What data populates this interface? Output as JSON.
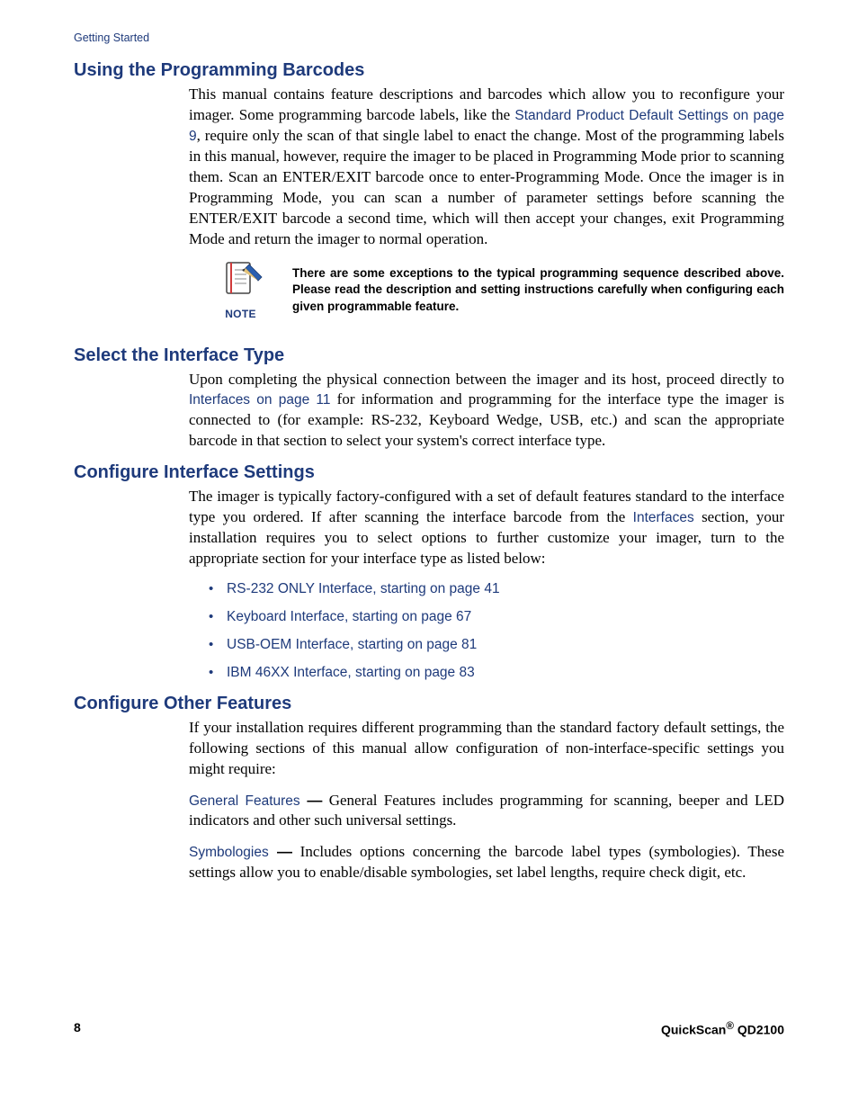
{
  "running_head": "Getting Started",
  "sections": {
    "using": {
      "title": "Using the Programming Barcodes",
      "p1a": "This manual contains feature descriptions and barcodes which allow you to reconfigure your imager. Some programming barcode labels, like the ",
      "link1": "Standard Product Default Settings on page 9",
      "p1b": ", require only the scan of that single label to enact the change. Most of the programming labels in this manual, however, require the imager to be placed in Programming Mode prior to scanning them. Scan an ENTER/EXIT barcode once to enter-Programming Mode. Once the imager is in Programming Mode, you can scan a number of parameter settings before scanning the ENTER/EXIT barcode a second time, which will then accept your changes, exit Programming Mode and return the imager to normal operation.",
      "note_label": "NOTE",
      "note_text": "There are some exceptions to the typical programming sequence described above. Please read the description and setting instructions carefully when configuring each given programmable feature."
    },
    "select": {
      "title": "Select the Interface Type",
      "p1a": "Upon completing the physical connection between the imager and its host, proceed directly to ",
      "link1": "Interfaces on page 11",
      "p1b": " for information and programming for the interface type the imager is connected to (for example: RS-232, Keyboard Wedge, USB, etc.) and scan the appropriate barcode in that section to select your system's correct interface type."
    },
    "configure": {
      "title": "Configure Interface Settings",
      "p1a": "The imager is typically factory-configured with a set of default features standard to the interface type you ordered. If after scanning the interface barcode from the ",
      "link1": "Interfaces",
      "p1b": " section, your installation requires you to select  options to further customize your imager, turn to the appropriate section for your interface type as listed below:",
      "items": [
        "RS-232 ONLY Interface, starting on page 41",
        "Keyboard Interface, starting on page 67",
        "USB-OEM Interface, starting on page 81",
        "IBM 46XX Interface, starting on page 83"
      ]
    },
    "other": {
      "title": "Configure Other Features",
      "p1": "If your installation requires different programming than the standard factory default settings, the following sections of this manual allow configuration of non-interface-specific settings you might require:",
      "gf_link": "General Features",
      "gf_text": " General Features includes programming for scanning, beeper and LED indicators and other such universal settings.",
      "sym_link": "Symbologies",
      "sym_text": " Includes options concerning the barcode label types (symbologies). These settings allow you to enable/disable symbologies, set label lengths, require check digit, etc."
    }
  },
  "footer": {
    "page": "8",
    "product_a": "QuickScan",
    "product_b": " QD2100"
  }
}
